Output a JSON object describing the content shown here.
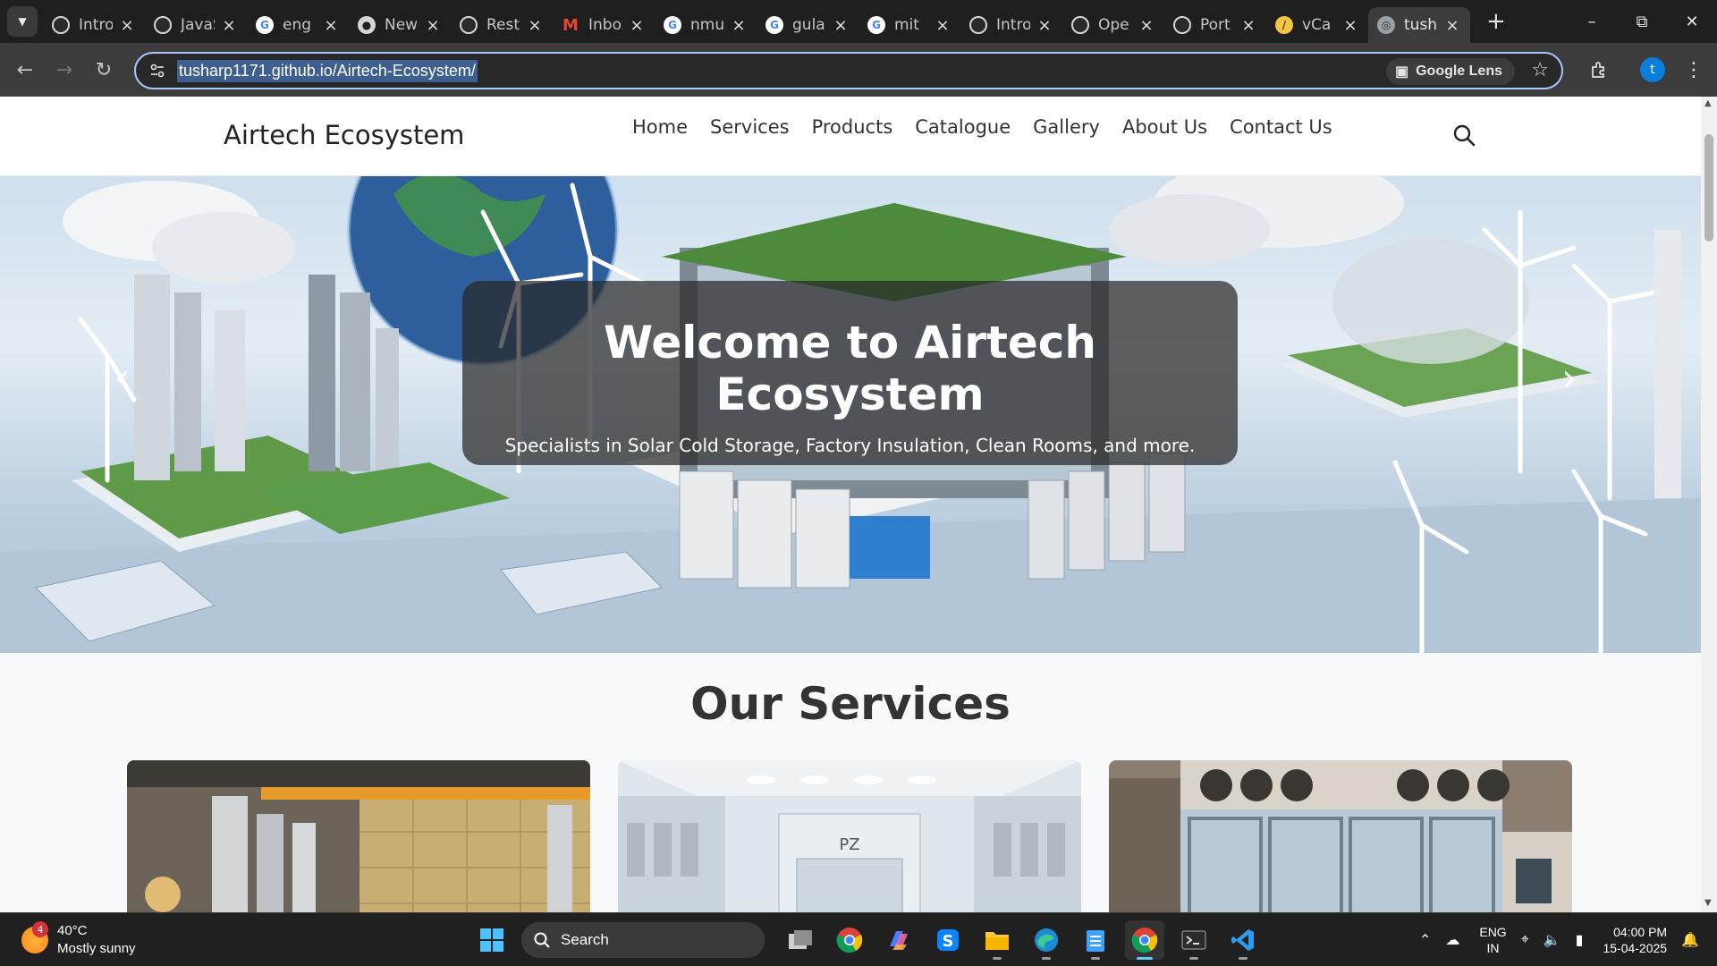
{
  "browser": {
    "tabs": [
      {
        "title": "Introduction",
        "favicon": "chatgpt-icon"
      },
      {
        "title": "JavaScript",
        "favicon": "chatgpt-icon"
      },
      {
        "title": "eng",
        "favicon": "google-icon"
      },
      {
        "title": "New",
        "favicon": "github-icon"
      },
      {
        "title": "Rest",
        "favicon": "chatgpt-icon"
      },
      {
        "title": "Inbox",
        "favicon": "gmail-icon"
      },
      {
        "title": "nmu",
        "favicon": "google-icon"
      },
      {
        "title": "gula",
        "favicon": "google-icon"
      },
      {
        "title": "mit",
        "favicon": "google-icon"
      },
      {
        "title": "Intro",
        "favicon": "chatgpt-icon"
      },
      {
        "title": "Ope",
        "favicon": "chatgpt-icon"
      },
      {
        "title": "Port",
        "favicon": "chatgpt-icon"
      },
      {
        "title": "vCa",
        "favicon": "vcard-icon"
      },
      {
        "title": "tush",
        "favicon": "globe-icon",
        "active": true
      }
    ],
    "url": "tusharp1171.github.io/Airtech-Ecosystem/",
    "lens_label": "Google Lens",
    "profile_initial": "t"
  },
  "site": {
    "brand": "Airtech Ecosystem",
    "nav": [
      "Home",
      "Services",
      "Products",
      "Catalogue",
      "Gallery",
      "About Us",
      "Contact Us"
    ],
    "hero": {
      "title": "Welcome to Airtech Ecosystem",
      "subtitle": "Specialists in Solar Cold Storage, Factory Insulation, Clean Rooms, and more."
    },
    "services_title": "Our Services"
  },
  "taskbar": {
    "weather": {
      "temp": "40°C",
      "condition": "Mostly sunny",
      "badge": "4"
    },
    "search_label": "Search",
    "lang_top": "ENG",
    "lang_bottom": "IN",
    "time": "04:00 PM",
    "date": "15-04-2025"
  }
}
